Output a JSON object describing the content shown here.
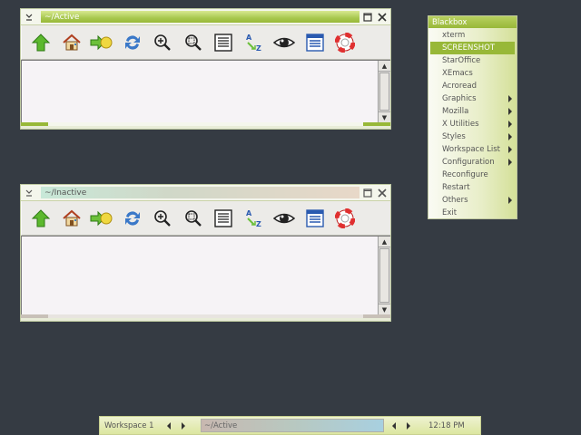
{
  "windows": {
    "active": {
      "title": "~/Active",
      "menu_glyph": "⌄",
      "max_glyph": "☐",
      "close_glyph": "✕"
    },
    "inactive": {
      "title": "~/Inactive",
      "menu_glyph": "⌄",
      "max_glyph": "☐",
      "close_glyph": "✕"
    }
  },
  "toolbar_icons": [
    "up-arrow-icon",
    "home-icon",
    "go-arrow-icon",
    "reload-icon",
    "zoom-in-icon",
    "zoom-fit-icon",
    "view-list-icon",
    "sort-az-icon",
    "eye-icon",
    "detail-list-icon",
    "help-lifebuoy-icon"
  ],
  "scrollbar": {
    "up_glyph": "▲",
    "down_glyph": "▼"
  },
  "rootmenu": {
    "title": "Blackbox",
    "items": [
      {
        "label": "xterm",
        "submenu": false
      },
      {
        "label": "SCREENSHOT",
        "submenu": false,
        "selected": true
      },
      {
        "label": "StarOffice",
        "submenu": false
      },
      {
        "label": "XEmacs",
        "submenu": false
      },
      {
        "label": "Acroread",
        "submenu": false
      },
      {
        "label": "Graphics",
        "submenu": true
      },
      {
        "label": "Mozilla",
        "submenu": true
      },
      {
        "label": "X Utilities",
        "submenu": true
      },
      {
        "label": "Styles",
        "submenu": true
      },
      {
        "label": "Workspace List",
        "submenu": true
      },
      {
        "label": "Configuration",
        "submenu": true
      },
      {
        "label": "Reconfigure",
        "submenu": false
      },
      {
        "label": "Restart",
        "submenu": false
      },
      {
        "label": "Others",
        "submenu": true
      },
      {
        "label": "Exit",
        "submenu": false
      }
    ]
  },
  "taskbar": {
    "workspace": "Workspace 1",
    "window": "~/Active",
    "clock": "12:18 PM"
  },
  "colors": {
    "desktop": "#353b43",
    "accent": "#98b838",
    "title_active": "#a8c850"
  }
}
